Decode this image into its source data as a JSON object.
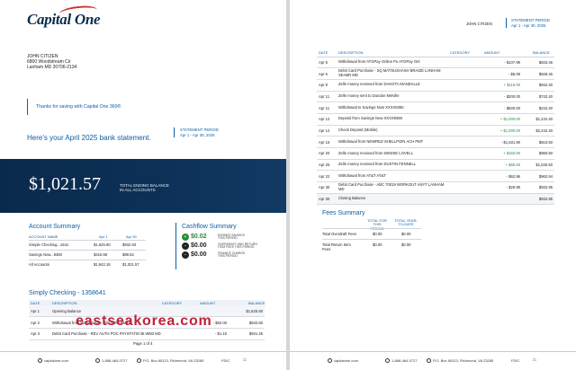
{
  "brand": {
    "logo_text": "Capital One",
    "accent": "#d03027",
    "primary": "#0b5ea8",
    "navy": "#0a2a4d"
  },
  "left": {
    "address": [
      "JOHN CITIZEN",
      "6800 Woodstream Cir",
      "Lanham MD 20706-2134"
    ],
    "thanks": "Thanks for saving with Capital One 360®",
    "hero_text": "Here's your April 2025 bank statement.",
    "statement_period_label": "STATEMENT PERIOD",
    "statement_period": "Apr 1 - Apr 30, 2025",
    "total_balance": "$1,021.57",
    "total_balance_label": [
      "TOTAL ENDING BALANCE",
      "IN ALL ACCOUNTS"
    ],
    "account_summary": {
      "title": "Account Summary",
      "headers": [
        "ACCOUNT NAME",
        "Apr 1",
        "Apr 30"
      ],
      "rows": [
        [
          "Simple Checking...1641",
          "$1,625.60",
          "$932.93"
        ],
        [
          "Savings Now...9360",
          "$416.58",
          "$88.62"
        ],
        [
          "All Accounts",
          "$1,842.18",
          "$1,021.57"
        ]
      ]
    },
    "cashflow": {
      "title": "Cashflow Summary",
      "items": [
        {
          "icon": "plus",
          "amount": "$0.02",
          "label": [
            "EARNED SAVINGS",
            "THIS PERIOD"
          ],
          "color": "#2a8a3a"
        },
        {
          "icon": "minus",
          "amount": "$0.00",
          "label": [
            "OVERDRAFT AND RETURN",
            "ITEM FEES THIS PERIOD"
          ],
          "color": "#222"
        },
        {
          "icon": "minus",
          "amount": "$0.00",
          "label": [
            "FINANCE CHARGE",
            "THIS PERIOD"
          ],
          "color": "#222"
        }
      ]
    },
    "checking": {
      "title": "Simply Checking - 1358641",
      "headers": [
        "DATE",
        "DESCRIPTION",
        "CATEGORY",
        "AMOUNT",
        "BALANCE"
      ],
      "rows": [
        [
          "Apr 1",
          "Opening Balance",
          "",
          "",
          "$1,625.60"
        ],
        [
          "Apr 2",
          "Withdrawal from Woodstream Villa WEB PMTS",
          "",
          "- $82.00",
          "$942.60"
        ],
        [
          "Apr 3",
          "Debit Card Purchase - REV AUTH POC PAYSTATIO BI.WEB MD",
          "",
          "- $1.15",
          "$941.45"
        ]
      ]
    },
    "page_number": "Page 1 of 4"
  },
  "right": {
    "header_name": "JOHN CITIZEN",
    "statement_period_label": "STATEMENT PERIOD",
    "statement_period": "Apr 1 - Apr 30, 2025",
    "headers": [
      "DATE",
      "DESCRIPTION",
      "CATEGORY",
      "AMOUNT",
      "BALANCE"
    ],
    "rows": [
      [
        "Apr 5",
        "Withdrawal from ATGPay Online Pu ATGPay Onl",
        "",
        "- $107.99",
        "$833.46"
      ],
      [
        "Apr 5",
        "Debit Card Purchase - SQ MATSUSHASH BRAIZE LANHAM SEABR MD",
        "",
        "- $5.08",
        "$828.46"
      ],
      [
        "Apr 9",
        "Zelle money received from DAKOTA MANDALLE",
        "",
        "+ $115.00",
        "$942.40"
      ],
      [
        "Apr 11",
        "Zelle money sent to Dundon Melville",
        "",
        "- $200.00",
        "$742.40"
      ],
      [
        "Apr 11",
        "Withdrawal to Savings Now XXXX9360",
        "",
        "- $500.00",
        "$242.40"
      ],
      [
        "Apr 12",
        "Deposit from Savings Now XXXX9360",
        "",
        "+ $1,000.00",
        "$1,242.40"
      ],
      [
        "Apr 12",
        "Check Deposit (Mobile)",
        "",
        "+ $1,000.00",
        "$2,242.40"
      ],
      [
        "Apr 15",
        "Withdrawal from NEWREZ-SHELLPOIN ACH PMT",
        "",
        "- $1,631.90",
        "$810.50"
      ],
      [
        "Apr 20",
        "Zelle money received from DENISE LOVELL",
        "",
        "+ $150.00",
        "$960.50"
      ],
      [
        "Apr 25",
        "Zelle money received from DUSTIN FENNELL",
        "",
        "+ $65.00",
        "$1,025.50"
      ],
      [
        "Apr 22",
        "Withdrawal from AT&T AT&T",
        "",
        "- $62.96",
        "$962.94"
      ],
      [
        "Apr 30",
        "Debit Card Purchase - ABC 70019 WORKOUT ANYT LANHAM MD",
        "",
        "- $29.99",
        "$932.95"
      ],
      [
        "Apr 30",
        "Closing Balance",
        "",
        "",
        "$932.95"
      ]
    ],
    "fees": {
      "title": "Fees Summary",
      "headers": [
        "TOTAL FOR THIS PERIOD",
        "TOTAL YEAR-TO-DATE"
      ],
      "rows": [
        [
          "Total Overdraft Fees",
          "$0.00",
          "$0.00"
        ],
        [
          "Total Return Item Fees",
          "$0.00",
          "$0.00"
        ]
      ]
    }
  },
  "footer": {
    "site": "capitalone.com",
    "phone": "1-888-464-0727",
    "address": "P.O. Box 85123, Richmond, VA 23285",
    "fdic": "FDIC"
  },
  "watermark": "eastseakorea.com"
}
